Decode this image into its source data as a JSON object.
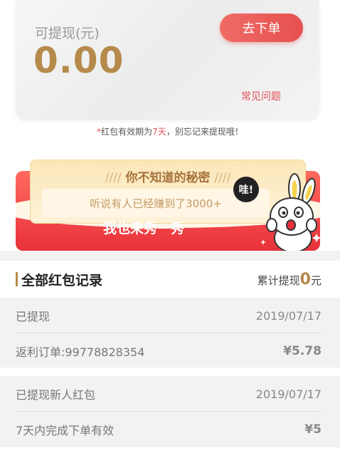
{
  "balance": {
    "label": "可提现(元)",
    "value": "0.00",
    "order_button": "去下单",
    "faq": "常见问题"
  },
  "notice": {
    "star": "*",
    "prefix": "红包有效期为",
    "days": "7天",
    "suffix": "，别忘记来提现哦！"
  },
  "promo": {
    "title": "你不知道的秘密",
    "subtitle": "听说有人已经赚到了3000+",
    "cta": "我也来秀一秀",
    "bubble": "哇!"
  },
  "records": {
    "title": "全部红包记录",
    "cumulative_label": "累计提现",
    "cumulative_value": "0",
    "cumulative_unit": "元",
    "items": [
      {
        "status": "已提现",
        "date": "2019/07/17",
        "desc": "返利订单:99778828354",
        "amount": "¥5.78"
      },
      {
        "status": "已提现新人红包",
        "date": "2019/07/17",
        "desc": "7天内完成下单有效",
        "amount": "¥5"
      }
    ]
  },
  "colors": {
    "accent_gold": "#b58a4a",
    "accent_red": "#e6504f"
  }
}
